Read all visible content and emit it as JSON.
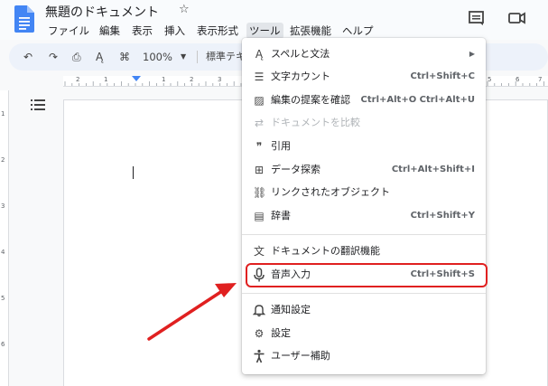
{
  "document": {
    "title": "無題のドキュメント",
    "menus": [
      "ファイル",
      "編集",
      "表示",
      "挿入",
      "表示形式",
      "ツール",
      "拡張機能",
      "ヘルプ"
    ],
    "active_menu": "ツール"
  },
  "toolbar": {
    "zoom": "100%",
    "style": "標準テキ"
  },
  "ruler": {
    "numbers": [
      "2",
      "1",
      "1",
      "2",
      "3",
      "4",
      "5",
      "6",
      "7",
      "8"
    ],
    "vnumbers": [
      "1",
      "2",
      "3",
      "4",
      "5",
      "6"
    ]
  },
  "tools_menu": {
    "items": [
      {
        "label": "スペルと文法",
        "shortcut": "",
        "icon": "spellcheck-icon",
        "glyph": "Ą"
      },
      {
        "label": "文字カウント",
        "shortcut": "Ctrl+Shift+C",
        "icon": "word-count-icon",
        "glyph": "☰"
      },
      {
        "label": "編集の提案を確認",
        "shortcut": "Ctrl+Alt+O Ctrl+Alt+U",
        "icon": "review-suggestions-icon",
        "glyph": "▨"
      },
      {
        "label": "ドキュメントを比較",
        "shortcut": "",
        "icon": "compare-icon",
        "glyph": "⇄"
      },
      {
        "label": "引用",
        "shortcut": "",
        "icon": "citation-icon",
        "glyph": "❞"
      },
      {
        "label": "データ探索",
        "shortcut": "Ctrl+Alt+Shift+I",
        "icon": "explore-icon",
        "glyph": "⊞"
      },
      {
        "label": "リンクされたオブジェクト",
        "shortcut": "",
        "icon": "linked-objects-icon",
        "glyph": "⛓"
      },
      {
        "label": "辞書",
        "shortcut": "Ctrl+Shift+Y",
        "icon": "dictionary-icon",
        "glyph": "▤"
      },
      {
        "label": "ドキュメントの翻訳機能",
        "shortcut": "",
        "icon": "translate-icon",
        "glyph": "文"
      },
      {
        "label": "音声入力",
        "shortcut": "Ctrl+Shift+S",
        "icon": "microphone-icon",
        "glyph": "🎙"
      },
      {
        "label": "通知設定",
        "shortcut": "",
        "icon": "bell-icon",
        "glyph": "🔔"
      },
      {
        "label": "設定",
        "shortcut": "",
        "icon": "preferences-icon",
        "glyph": "⚙"
      },
      {
        "label": "ユーザー補助",
        "shortcut": "",
        "icon": "accessibility-icon",
        "glyph": "♿"
      }
    ]
  },
  "colors": {
    "annotation": "#e02020",
    "docs_blue": "#4285f4"
  }
}
